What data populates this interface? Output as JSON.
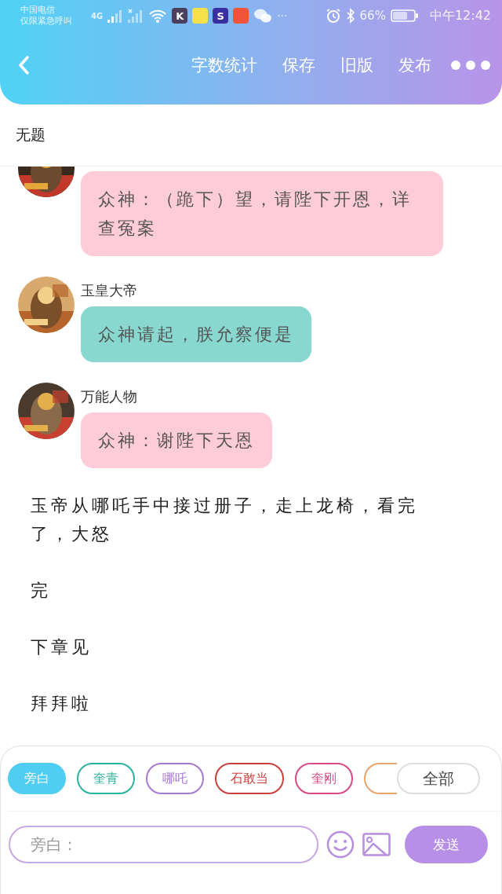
{
  "status_bar": {
    "carrier": "中国电信",
    "carrier_note": "仅限紧急呼叫",
    "network": "4G",
    "apps": [
      {
        "glyph": "K",
        "color": "#4a3f5c"
      },
      {
        "color": "#f3e04a"
      },
      {
        "glyph": "S",
        "color": "#3a2fa0"
      },
      {
        "color": "#f0553c"
      }
    ],
    "more": "···",
    "battery": "66%",
    "time": "中午12:42"
  },
  "toolbar": {
    "actions": [
      "字数统计",
      "保存",
      "旧版",
      "发布"
    ]
  },
  "title": "无题",
  "messages": [
    {
      "kind": "chat",
      "text": "众神：（跪下）望，请陛下开恩，详查冤案",
      "color": "#fecbd8"
    },
    {
      "kind": "chat",
      "name": "玉皇大帝",
      "text": "众神请起，朕允察便是",
      "color": "#88d8cf"
    },
    {
      "kind": "chat",
      "name": "万能人物",
      "text": "众神：谢陛下天恩",
      "color": "#fecbd8"
    },
    {
      "kind": "narration",
      "text": "玉帝从哪吒手中接过册子，走上龙椅，看完了，大怒"
    },
    {
      "kind": "narration",
      "text": "完"
    },
    {
      "kind": "narration",
      "text": "下章见"
    },
    {
      "kind": "narration",
      "text": "拜拜啦"
    }
  ],
  "roles": [
    {
      "label": "旁白",
      "color": "#4fcdf3",
      "selected": true
    },
    {
      "label": "奎青",
      "color": "#2ab3a0",
      "selected": false
    },
    {
      "label": "哪吒",
      "color": "#a77ad0",
      "selected": false
    },
    {
      "label": "石敢当",
      "color": "#c9413e",
      "selected": false
    },
    {
      "label": "奎刚",
      "color": "#d84a86",
      "selected": false
    },
    {
      "color": "#e8a46a",
      "selected": false
    }
  ],
  "all_button": "全部",
  "input": {
    "placeholder": "旁白："
  },
  "send_button": "发送"
}
